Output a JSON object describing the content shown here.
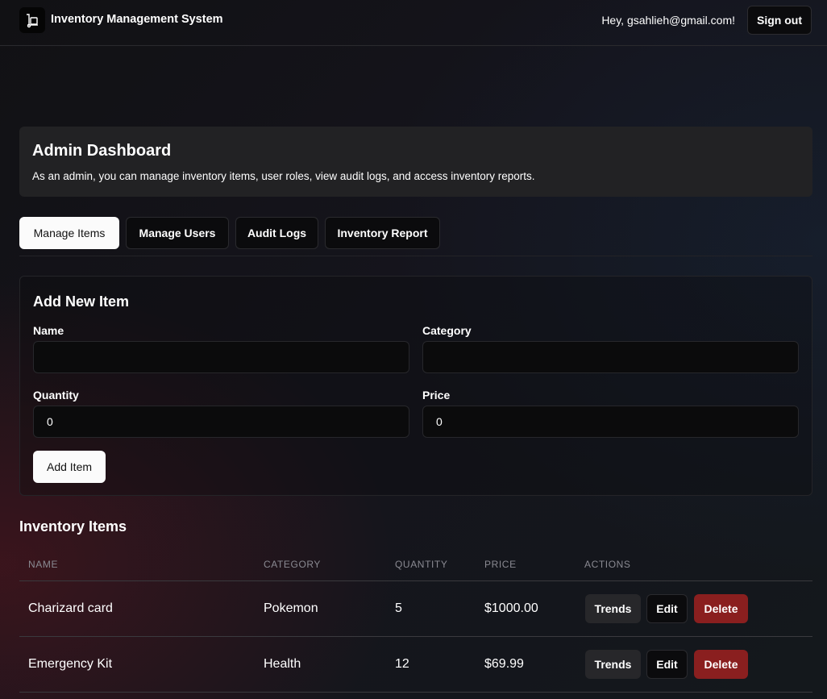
{
  "header": {
    "app_title": "Inventory Management System",
    "logo_icon": "hand-truck-icon",
    "greeting": "Hey, gsahlieh@gmail.com!",
    "signout_label": "Sign out"
  },
  "dashboard": {
    "title": "Admin Dashboard",
    "description": "As an admin, you can manage inventory items, user roles, view audit logs, and access inventory reports."
  },
  "tabs": [
    {
      "label": "Manage Items",
      "active": true
    },
    {
      "label": "Manage Users",
      "active": false
    },
    {
      "label": "Audit Logs",
      "active": false
    },
    {
      "label": "Inventory Report",
      "active": false
    }
  ],
  "form": {
    "title": "Add New Item",
    "name_label": "Name",
    "name_value": "",
    "category_label": "Category",
    "category_value": "",
    "quantity_label": "Quantity",
    "quantity_value": "0",
    "price_label": "Price",
    "price_value": "0",
    "submit_label": "Add Item"
  },
  "inventory": {
    "title": "Inventory Items",
    "columns": [
      "NAME",
      "CATEGORY",
      "QUANTITY",
      "PRICE",
      "ACTIONS"
    ],
    "rows": [
      {
        "name": "Charizard card",
        "category": "Pokemon",
        "quantity": "5",
        "price": "$1000.00"
      },
      {
        "name": "Emergency Kit",
        "category": "Health",
        "quantity": "12",
        "price": "$69.99"
      }
    ],
    "actions": {
      "trends": "Trends",
      "edit": "Edit",
      "delete": "Delete"
    }
  },
  "colors": {
    "delete": "#8a1f1f",
    "primary_button": "#fbfbfb",
    "card": "#222224"
  }
}
